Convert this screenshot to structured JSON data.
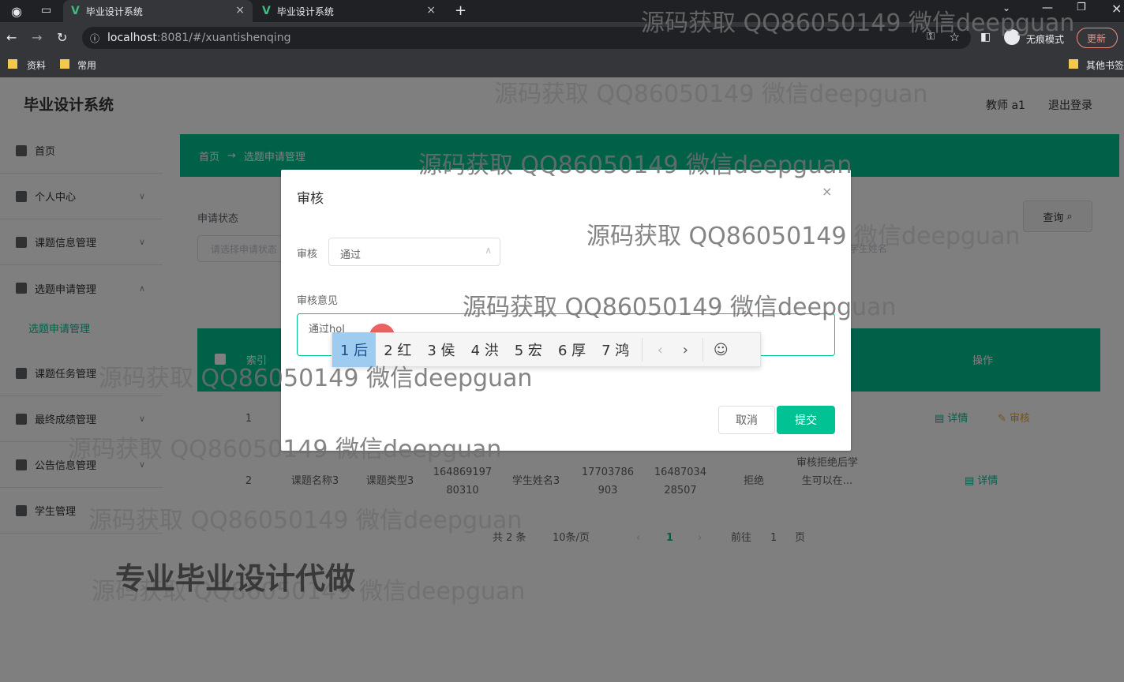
{
  "browser": {
    "tabs": [
      {
        "title": "毕业设计系统",
        "active": true
      },
      {
        "title": "毕业设计系统",
        "active": false
      }
    ],
    "url_host": "localhost",
    "url_rest": ":8081/#/xuantishenqing",
    "incognito_label": "无痕模式",
    "update_label": "更新",
    "bookmarks": [
      "资料",
      "常用"
    ],
    "other_bookmarks": "其他书签"
  },
  "app": {
    "title": "毕业设计系统",
    "user": "教师 a1",
    "logout": "退出登录",
    "sidebar": [
      {
        "label": "首页"
      },
      {
        "label": "个人中心"
      },
      {
        "label": "课题信息管理"
      },
      {
        "label": "选题申请管理"
      },
      {
        "label": "课题任务管理"
      },
      {
        "label": "最终成绩管理"
      },
      {
        "label": "公告信息管理"
      },
      {
        "label": "学生管理"
      }
    ],
    "sidebar_sub": "选题申请管理",
    "breadcrumb_home": "首页",
    "breadcrumb_current": "选题申请管理",
    "filter_label": "申请状态",
    "filter_placeholder": "请选择申请状态",
    "student_name_placeholder": "学生姓名",
    "query_button": "查询",
    "table_header_index": "索引",
    "table_header_action": "操作",
    "rows": [
      {
        "index": "1",
        "detail": "详情",
        "review": "审核"
      },
      {
        "index": "2",
        "topic": "课题名称3",
        "type": "课题类型3",
        "account": "16486919780310",
        "student": "学生姓名3",
        "phone": "17703786903",
        "tid": "1648703428507",
        "status": "拒绝",
        "opinion": "审核拒绝后学生可以在...",
        "detail": "详情"
      }
    ],
    "pagination": {
      "total": "共 2 条",
      "page_size": "10条/页",
      "current": "1",
      "goto_prefix": "前往",
      "goto_value": "1",
      "goto_suffix": "页"
    }
  },
  "dialog": {
    "title": "审核",
    "review_label": "审核",
    "review_value": "通过",
    "opinion_label": "审核意见",
    "opinion_value": "通过hol",
    "cancel": "取消",
    "submit": "提交"
  },
  "ime": {
    "candidates": [
      "1 后",
      "2 红",
      "3 侯",
      "4 洪",
      "5 宏",
      "6 厚",
      "7 鸿"
    ],
    "prev": "‹",
    "next": "›",
    "emoji": "☺"
  },
  "watermarks": {
    "text": "源码获取 QQ86050149 微信deepguan",
    "slogan": "专业毕业设计代做"
  },
  "colors": {
    "accent": "#00c292",
    "chrome": "#35363a"
  }
}
